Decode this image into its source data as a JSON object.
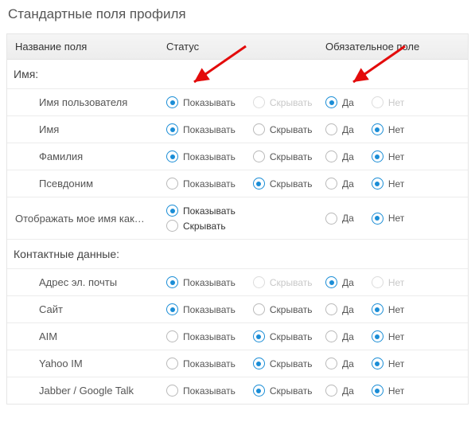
{
  "title": "Стандартные поля профиля",
  "header": {
    "field_name": "Название поля",
    "status": "Статус",
    "required": "Обязательное поле"
  },
  "sections": [
    {
      "title": "Имя:",
      "rows": [
        {
          "label": "Имя пользователя",
          "show_label": "Показывать",
          "hide_label": "Скрывать",
          "yes_label": "Да",
          "no_label": "Нет",
          "status": "show",
          "required": "yes",
          "locked": true
        },
        {
          "label": "Имя",
          "show_label": "Показывать",
          "hide_label": "Скрывать",
          "yes_label": "Да",
          "no_label": "Нет",
          "status": "show",
          "required": "no",
          "locked": false
        },
        {
          "label": "Фамилия",
          "show_label": "Показывать",
          "hide_label": "Скрывать",
          "yes_label": "Да",
          "no_label": "Нет",
          "status": "show",
          "required": "no",
          "locked": false
        },
        {
          "label": "Псевдоним",
          "show_label": "Показывать",
          "hide_label": "Скрывать",
          "yes_label": "Да",
          "no_label": "Нет",
          "status": "hide",
          "required": "no",
          "locked": false
        },
        {
          "label": "Отображать мое имя как…",
          "show_label": "Показывать",
          "hide_label": "Скрывать",
          "yes_label": "Да",
          "no_label": "Нет",
          "status": "show",
          "required": "no",
          "locked": false,
          "stacked": true
        }
      ]
    },
    {
      "title": "Контактные данные:",
      "rows": [
        {
          "label": "Адрес эл. почты",
          "show_label": "Показывать",
          "hide_label": "Скрывать",
          "yes_label": "Да",
          "no_label": "Нет",
          "status": "show",
          "required": "yes",
          "locked": true
        },
        {
          "label": "Сайт",
          "show_label": "Показывать",
          "hide_label": "Скрывать",
          "yes_label": "Да",
          "no_label": "Нет",
          "status": "show",
          "required": "no",
          "locked": false
        },
        {
          "label": "AIM",
          "show_label": "Показывать",
          "hide_label": "Скрывать",
          "yes_label": "Да",
          "no_label": "Нет",
          "status": "hide",
          "required": "no",
          "locked": false
        },
        {
          "label": "Yahoo IM",
          "show_label": "Показывать",
          "hide_label": "Скрывать",
          "yes_label": "Да",
          "no_label": "Нет",
          "status": "hide",
          "required": "no",
          "locked": false
        },
        {
          "label": "Jabber / Google Talk",
          "show_label": "Показывать",
          "hide_label": "Скрывать",
          "yes_label": "Да",
          "no_label": "Нет",
          "status": "hide",
          "required": "no",
          "locked": false
        }
      ]
    }
  ]
}
